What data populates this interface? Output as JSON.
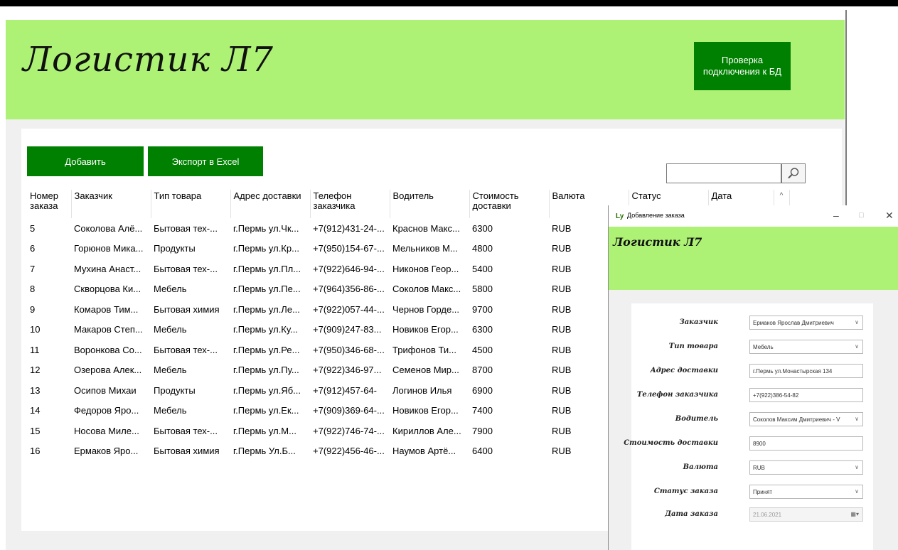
{
  "main": {
    "app_title": "Логистик Л7",
    "db_check_button": "Проверка подключения к БД",
    "add_button": "Добавить",
    "export_button": "Экспорт в Excel",
    "search_value": "",
    "columns": [
      "Номер заказа",
      "Заказчик",
      "Тип товара",
      "Адрес доставки",
      "Телефон заказчика",
      "Водитель",
      "Стоимость доставки",
      "Валюта",
      "Статус",
      "Дата"
    ],
    "rows": [
      [
        "5",
        "Соколова Алё...",
        "Бытовая тех-...",
        "г.Пермь ул.Чк...",
        "+7(912)431-24-...",
        "Краснов Макс...",
        "6300",
        "RUB"
      ],
      [
        "6",
        "Горюнов Мика...",
        "Продукты",
        "г.Пермь ул.Кр...",
        "+7(950)154-67-...",
        "Мельников М...",
        "4800",
        "RUB"
      ],
      [
        "7",
        "Мухина Анаст...",
        "Бытовая тех-...",
        "г.Пермь ул.Пл...",
        "+7(922)646-94-...",
        "Никонов Геор...",
        "5400",
        "RUB"
      ],
      [
        "8",
        "Скворцова Ки...",
        "Мебель",
        "г.Пермь ул.Пе...",
        "+7(964)356-86-...",
        "Соколов Макс...",
        "5800",
        "RUB"
      ],
      [
        "9",
        "Комаров Тим...",
        "Бытовая химия",
        "г.Пермь ул.Ле...",
        "+7(922)057-44-...",
        "Чернов Горде...",
        "9700",
        "RUB"
      ],
      [
        "10",
        "Макаров Степ...",
        "Мебель",
        "г.Пермь ул.Ку...",
        "+7(909)247-83...",
        "Новиков Егор...",
        "6300",
        "RUB"
      ],
      [
        "11",
        "Воронкова Со...",
        "Бытовая тех-...",
        "г.Пермь ул.Ре...",
        "+7(950)346-68-...",
        "Трифонов Ти...",
        "4500",
        "RUB"
      ],
      [
        "12",
        "Озерова Алек...",
        "Мебель",
        "г.Пермь ул.Пу...",
        "+7(922)346-97...",
        "Семенов Мир...",
        "8700",
        "RUB"
      ],
      [
        "13",
        "Осипов Михаи",
        "Продукты",
        "г.Пермь ул.Яб...",
        "+7(912)457-64-",
        "Логинов Илья",
        "6900",
        "RUB"
      ],
      [
        "14",
        "Федоров Яро...",
        "Мебель",
        "г.Пермь ул.Ек...",
        "+7(909)369-64-...",
        "Новиков Егор...",
        "7400",
        "RUB"
      ],
      [
        "15",
        "Носова Миле...",
        "Бытовая тех-...",
        "г.Пермь ул.М...",
        "+7(922)746-74-...",
        "Кириллов Але...",
        "7900",
        "RUB"
      ],
      [
        "16",
        "Ермаков Яро...",
        "Бытовая химия",
        "г.Пермь Ул.Б...",
        "+7(922)456-46-...",
        "Наумов Артё...",
        "6400",
        "RUB"
      ]
    ]
  },
  "dialog": {
    "window_title": "Добавление заказа",
    "app_title": "Логистик Л7",
    "fields": [
      {
        "label": "Заказчик",
        "value": "Ермаков Ярослав Дмитриевич",
        "type": "select"
      },
      {
        "label": "Тип товара",
        "value": "Мебель",
        "type": "select"
      },
      {
        "label": "Адрес доставки",
        "value": "г.Пермь ул.Монастырская 134",
        "type": "text"
      },
      {
        "label": "Телефон заказчика",
        "value": "+7(922)386-54-82",
        "type": "text"
      },
      {
        "label": "Водитель",
        "value": "Соколов Максим Дмитриевич - V",
        "type": "select"
      },
      {
        "label": "Стоимость доставки",
        "value": "8900",
        "type": "text"
      },
      {
        "label": "Валюта",
        "value": "RUB",
        "type": "select"
      },
      {
        "label": "Статус заказа",
        "value": "Принят",
        "type": "select"
      },
      {
        "label": "Дата заказа",
        "value": "21.06.2021",
        "type": "date"
      }
    ]
  }
}
